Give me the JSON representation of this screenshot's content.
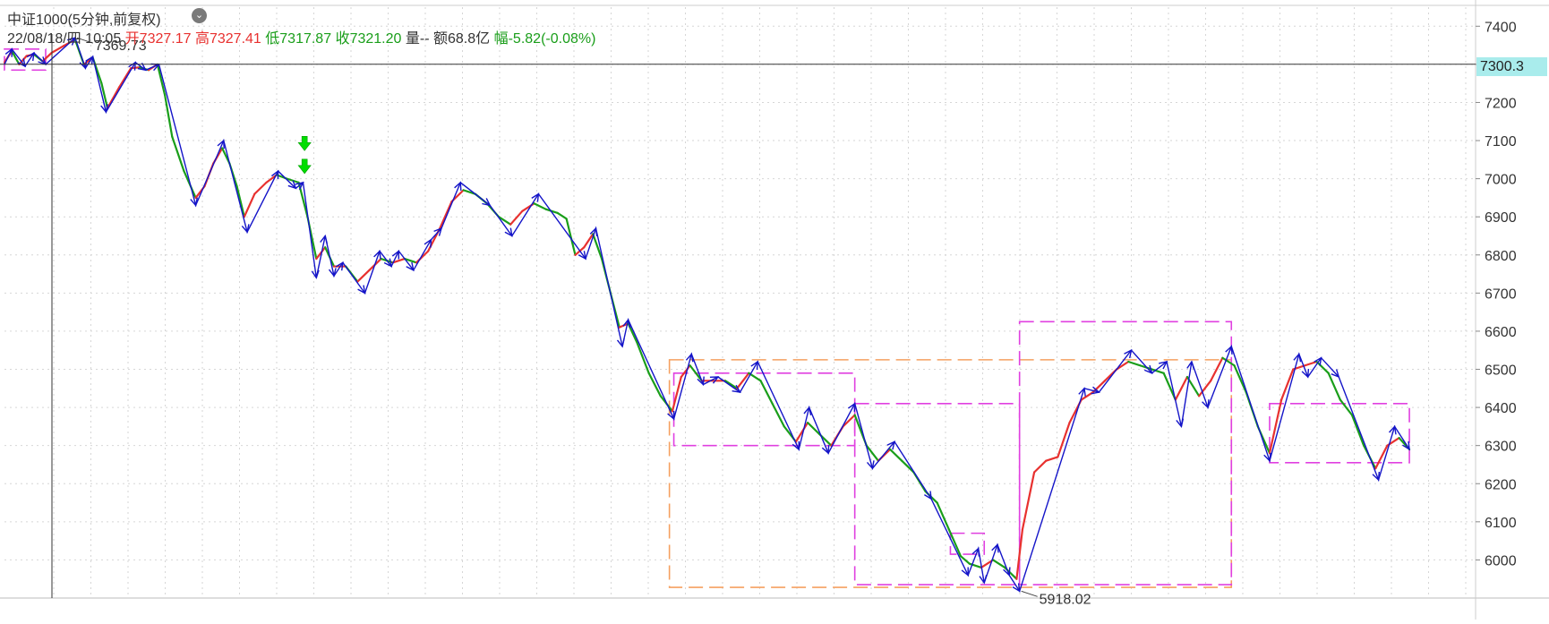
{
  "header": {
    "title": "中证1000(5分钟,前复权)",
    "dropdown_icon": "chevron-down-icon",
    "info": {
      "datetime": "22/08/18/四 10:05",
      "open": "开7327.17",
      "high": "高7327.41",
      "low": "低7317.87",
      "close": "收7321.20",
      "volume": "量--",
      "amount": "额68.8亿",
      "change": "幅-5.82(-0.08%)"
    }
  },
  "crosshair": {
    "price": 7300.3,
    "label": "7300.3"
  },
  "bottom_strip": {
    "text": ""
  },
  "colors": {
    "zigzag": "#1414c8",
    "up_candle": "#e8312f",
    "down_candle": "#1a9e1a",
    "orange_box": "#f5a060",
    "magenta_box": "#e040e0",
    "signal_arrow": "#00dd00",
    "crosshair": "#333333",
    "badge": "#a9ecec"
  },
  "chart_data": {
    "type": "line",
    "title": "中证1000(5分钟,前复权)",
    "xlabel": "",
    "ylabel": "",
    "ylim": [
      5900,
      7450
    ],
    "y_ticks": [
      6000,
      6100,
      6200,
      6300,
      6400,
      6500,
      6600,
      6700,
      6800,
      6900,
      7000,
      7100,
      7200,
      7300,
      7400
    ],
    "grid": true,
    "x_range": [
      0,
      1000
    ],
    "annotations": [
      {
        "text": "7369.73",
        "x": 48,
        "y": 7369.73
      },
      {
        "text": "5918.02",
        "x": 690,
        "y": 5918.02
      }
    ],
    "series": [
      {
        "kind": "zigzag",
        "points": [
          [
            0,
            7300
          ],
          [
            5,
            7340
          ],
          [
            14,
            7295
          ],
          [
            20,
            7330
          ],
          [
            28,
            7300
          ],
          [
            48,
            7369.73
          ],
          [
            55,
            7290
          ],
          [
            60,
            7320
          ],
          [
            69,
            7175
          ],
          [
            89,
            7305
          ],
          [
            96,
            7285
          ],
          [
            105,
            7300
          ],
          [
            130,
            6930
          ],
          [
            149,
            7100
          ],
          [
            165,
            6860
          ],
          [
            186,
            7020
          ],
          [
            198,
            6975
          ],
          [
            203,
            6990
          ],
          [
            212,
            6740
          ],
          [
            218,
            6850
          ],
          [
            224,
            6745
          ],
          [
            230,
            6780
          ],
          [
            245,
            6700
          ],
          [
            255,
            6810
          ],
          [
            263,
            6770
          ],
          [
            268,
            6810
          ],
          [
            278,
            6760
          ],
          [
            290,
            6840
          ],
          [
            297,
            6870
          ],
          [
            310,
            6990
          ],
          [
            330,
            6930
          ],
          [
            345,
            6850
          ],
          [
            363,
            6960
          ],
          [
            395,
            6790
          ],
          [
            402,
            6870
          ],
          [
            420,
            6560
          ],
          [
            424,
            6630
          ],
          [
            455,
            6370
          ],
          [
            467,
            6540
          ],
          [
            475,
            6460
          ],
          [
            485,
            6480
          ],
          [
            500,
            6440
          ],
          [
            512,
            6520
          ],
          [
            540,
            6290
          ],
          [
            547,
            6400
          ],
          [
            560,
            6280
          ],
          [
            578,
            6410
          ],
          [
            590,
            6240
          ],
          [
            605,
            6310
          ],
          [
            630,
            6160
          ],
          [
            655,
            5960
          ],
          [
            662,
            6030
          ],
          [
            666,
            5940
          ],
          [
            675,
            6040
          ],
          [
            683,
            5960
          ],
          [
            690,
            5918.02
          ],
          [
            734,
            6450
          ],
          [
            744,
            6440
          ],
          [
            766,
            6550
          ],
          [
            780,
            6490
          ],
          [
            790,
            6520
          ],
          [
            800,
            6350
          ],
          [
            807,
            6520
          ],
          [
            818,
            6400
          ],
          [
            834,
            6560
          ],
          [
            860,
            6260
          ],
          [
            880,
            6540
          ],
          [
            886,
            6480
          ],
          [
            895,
            6530
          ],
          [
            907,
            6480
          ],
          [
            934,
            6210
          ],
          [
            945,
            6350
          ],
          [
            955,
            6290
          ]
        ]
      },
      {
        "kind": "price",
        "points": [
          [
            0,
            7305
          ],
          [
            5,
            7335
          ],
          [
            10,
            7300
          ],
          [
            15,
            7322
          ],
          [
            20,
            7326
          ],
          [
            26,
            7308
          ],
          [
            32,
            7330
          ],
          [
            40,
            7348
          ],
          [
            48,
            7365
          ],
          [
            54,
            7300
          ],
          [
            60,
            7318
          ],
          [
            66,
            7250
          ],
          [
            70,
            7185
          ],
          [
            78,
            7240
          ],
          [
            86,
            7290
          ],
          [
            92,
            7292
          ],
          [
            98,
            7285
          ],
          [
            104,
            7300
          ],
          [
            109,
            7220
          ],
          [
            114,
            7110
          ],
          [
            122,
            7020
          ],
          [
            130,
            6950
          ],
          [
            136,
            6980
          ],
          [
            142,
            7040
          ],
          [
            148,
            7080
          ],
          [
            153,
            7040
          ],
          [
            158,
            6980
          ],
          [
            163,
            6900
          ],
          [
            170,
            6960
          ],
          [
            178,
            6990
          ],
          [
            185,
            7010
          ],
          [
            192,
            7000
          ],
          [
            200,
            6990
          ],
          [
            206,
            6900
          ],
          [
            212,
            6790
          ],
          [
            218,
            6820
          ],
          [
            224,
            6770
          ],
          [
            232,
            6770
          ],
          [
            240,
            6730
          ],
          [
            248,
            6760
          ],
          [
            256,
            6790
          ],
          [
            264,
            6780
          ],
          [
            272,
            6790
          ],
          [
            280,
            6780
          ],
          [
            288,
            6810
          ],
          [
            296,
            6870
          ],
          [
            304,
            6940
          ],
          [
            312,
            6970
          ],
          [
            320,
            6960
          ],
          [
            328,
            6935
          ],
          [
            336,
            6900
          ],
          [
            344,
            6880
          ],
          [
            352,
            6915
          ],
          [
            360,
            6935
          ],
          [
            368,
            6920
          ],
          [
            376,
            6910
          ],
          [
            382,
            6895
          ],
          [
            388,
            6800
          ],
          [
            394,
            6820
          ],
          [
            400,
            6855
          ],
          [
            406,
            6790
          ],
          [
            412,
            6700
          ],
          [
            418,
            6610
          ],
          [
            424,
            6620
          ],
          [
            430,
            6570
          ],
          [
            438,
            6490
          ],
          [
            446,
            6430
          ],
          [
            454,
            6390
          ],
          [
            460,
            6480
          ],
          [
            466,
            6510
          ],
          [
            474,
            6470
          ],
          [
            482,
            6470
          ],
          [
            490,
            6470
          ],
          [
            498,
            6450
          ],
          [
            506,
            6490
          ],
          [
            514,
            6470
          ],
          [
            522,
            6410
          ],
          [
            530,
            6350
          ],
          [
            538,
            6310
          ],
          [
            546,
            6360
          ],
          [
            554,
            6330
          ],
          [
            562,
            6300
          ],
          [
            570,
            6350
          ],
          [
            578,
            6380
          ],
          [
            586,
            6300
          ],
          [
            594,
            6260
          ],
          [
            602,
            6290
          ],
          [
            610,
            6260
          ],
          [
            618,
            6230
          ],
          [
            626,
            6180
          ],
          [
            634,
            6150
          ],
          [
            642,
            6080
          ],
          [
            650,
            6010
          ],
          [
            656,
            5990
          ],
          [
            664,
            5980
          ],
          [
            672,
            6000
          ],
          [
            680,
            5980
          ],
          [
            688,
            5950
          ],
          [
            692,
            6080
          ],
          [
            700,
            6230
          ],
          [
            708,
            6260
          ],
          [
            716,
            6270
          ],
          [
            724,
            6360
          ],
          [
            732,
            6420
          ],
          [
            740,
            6440
          ],
          [
            748,
            6470
          ],
          [
            756,
            6500
          ],
          [
            764,
            6520
          ],
          [
            772,
            6510
          ],
          [
            780,
            6500
          ],
          [
            788,
            6490
          ],
          [
            796,
            6420
          ],
          [
            804,
            6480
          ],
          [
            812,
            6430
          ],
          [
            820,
            6470
          ],
          [
            828,
            6530
          ],
          [
            836,
            6510
          ],
          [
            844,
            6440
          ],
          [
            852,
            6350
          ],
          [
            860,
            6280
          ],
          [
            868,
            6420
          ],
          [
            876,
            6500
          ],
          [
            884,
            6510
          ],
          [
            892,
            6520
          ],
          [
            900,
            6490
          ],
          [
            908,
            6420
          ],
          [
            916,
            6380
          ],
          [
            924,
            6300
          ],
          [
            932,
            6240
          ],
          [
            940,
            6300
          ],
          [
            948,
            6320
          ],
          [
            955,
            6290
          ]
        ]
      }
    ],
    "boxes": [
      {
        "color": "orange",
        "x0": 452,
        "x1": 834,
        "y0": 5928,
        "y1": 6525
      },
      {
        "color": "magenta",
        "x0": 455,
        "x1": 578,
        "y0": 6300,
        "y1": 6490
      },
      {
        "color": "magenta",
        "x0": 578,
        "x1": 690,
        "y0": 5935,
        "y1": 6410
      },
      {
        "color": "magenta",
        "x0": 690,
        "x1": 834,
        "y0": 5935,
        "y1": 6625
      },
      {
        "color": "magenta",
        "x0": 643,
        "x1": 666,
        "y0": 6015,
        "y1": 6070
      },
      {
        "color": "magenta",
        "x0": 860,
        "x1": 955,
        "y0": 6255,
        "y1": 6410
      },
      {
        "color": "magenta",
        "x0": 0,
        "x1": 28,
        "y0": 7285,
        "y1": 7340
      }
    ],
    "signals": [
      {
        "type": "arrow-down",
        "x": 204,
        "y": 7090
      },
      {
        "type": "arrow-down",
        "x": 204,
        "y": 7030
      }
    ]
  }
}
